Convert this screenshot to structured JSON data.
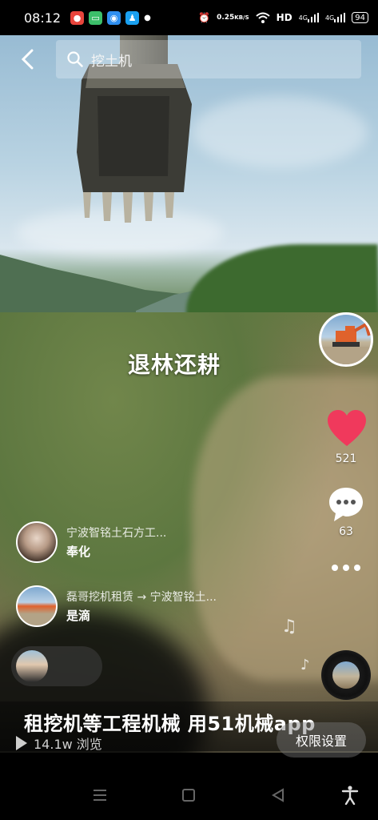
{
  "status_bar": {
    "time": "08:12",
    "network_speed_value": "0.25",
    "network_speed_unit": "KB/S",
    "network_type": "HD",
    "signal_1": "4G",
    "signal_2": "4G",
    "battery": "94",
    "icons": [
      "app-red-icon",
      "app-green-icon",
      "app-blue-icon",
      "qq-icon",
      "dot-icon",
      "alarm-icon",
      "wifi-icon",
      "signal-icon",
      "battery-icon"
    ]
  },
  "header": {
    "search_text": "挖土机",
    "icons": [
      "back-icon",
      "search-icon"
    ]
  },
  "video": {
    "overlay_title": "退林还耕"
  },
  "actions": {
    "like_count": "521",
    "comment_count": "63",
    "like_color": "#f0395c",
    "icons": [
      "heart-icon",
      "comment-icon",
      "more-icon",
      "music-disc-icon",
      "music-note-icon"
    ]
  },
  "recommendations": [
    {
      "title": "宁波智铭土石方工...",
      "subtitle": "奉化"
    },
    {
      "title": "磊哥挖机租赁 → 宁波智铭土...",
      "subtitle": "是滴"
    }
  ],
  "banner": {
    "text": "租挖机等工程机械  用51机械app",
    "views": "14.1w 浏览",
    "permission_button": "权限设置"
  },
  "nav_bar": {
    "icons": [
      "menu-icon",
      "home-icon",
      "back-triangle-icon",
      "accessibility-icon"
    ]
  }
}
